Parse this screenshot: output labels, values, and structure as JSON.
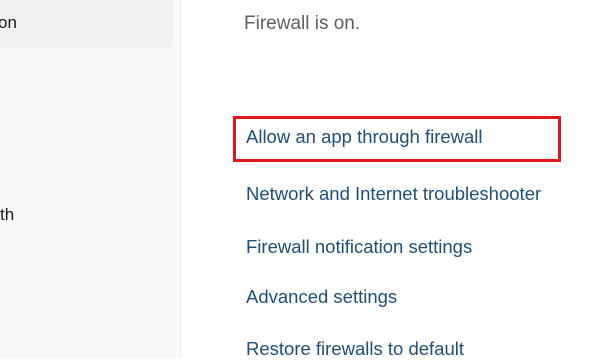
{
  "sidebar": {
    "items": [
      {
        "label": "on"
      },
      {
        "label": "th"
      }
    ]
  },
  "main": {
    "status": "Firewall is on.",
    "links": [
      {
        "label": "Allow an app through firewall"
      },
      {
        "label": "Network and Internet troubleshooter"
      },
      {
        "label": "Firewall notification settings"
      },
      {
        "label": "Advanced settings"
      },
      {
        "label": "Restore firewalls to default"
      }
    ]
  },
  "highlight": {
    "color": "#e01722",
    "target": "Allow an app through firewall"
  }
}
